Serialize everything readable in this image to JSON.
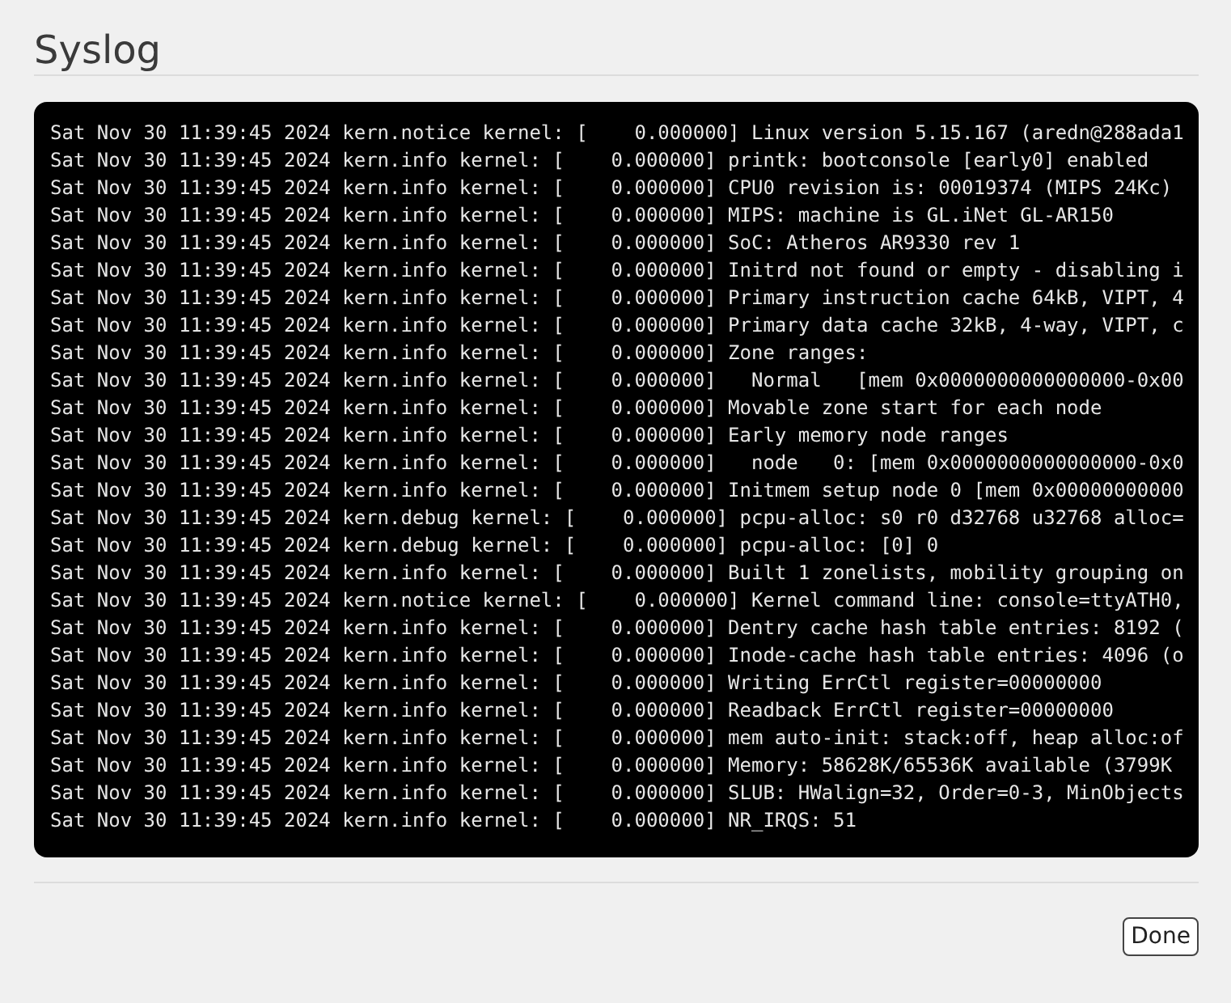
{
  "page": {
    "title": "Syslog"
  },
  "log": {
    "lines": [
      "Sat Nov 30 11:39:45 2024 kern.notice kernel: [    0.000000] Linux version 5.15.167 (aredn@288ada1",
      "Sat Nov 30 11:39:45 2024 kern.info kernel: [    0.000000] printk: bootconsole [early0] enabled",
      "Sat Nov 30 11:39:45 2024 kern.info kernel: [    0.000000] CPU0 revision is: 00019374 (MIPS 24Kc)",
      "Sat Nov 30 11:39:45 2024 kern.info kernel: [    0.000000] MIPS: machine is GL.iNet GL-AR150",
      "Sat Nov 30 11:39:45 2024 kern.info kernel: [    0.000000] SoC: Atheros AR9330 rev 1",
      "Sat Nov 30 11:39:45 2024 kern.info kernel: [    0.000000] Initrd not found or empty - disabling i",
      "Sat Nov 30 11:39:45 2024 kern.info kernel: [    0.000000] Primary instruction cache 64kB, VIPT, 4",
      "Sat Nov 30 11:39:45 2024 kern.info kernel: [    0.000000] Primary data cache 32kB, 4-way, VIPT, c",
      "Sat Nov 30 11:39:45 2024 kern.info kernel: [    0.000000] Zone ranges:",
      "Sat Nov 30 11:39:45 2024 kern.info kernel: [    0.000000]   Normal   [mem 0x0000000000000000-0x00",
      "Sat Nov 30 11:39:45 2024 kern.info kernel: [    0.000000] Movable zone start for each node",
      "Sat Nov 30 11:39:45 2024 kern.info kernel: [    0.000000] Early memory node ranges",
      "Sat Nov 30 11:39:45 2024 kern.info kernel: [    0.000000]   node   0: [mem 0x0000000000000000-0x0",
      "Sat Nov 30 11:39:45 2024 kern.info kernel: [    0.000000] Initmem setup node 0 [mem 0x00000000000",
      "Sat Nov 30 11:39:45 2024 kern.debug kernel: [    0.000000] pcpu-alloc: s0 r0 d32768 u32768 alloc=",
      "Sat Nov 30 11:39:45 2024 kern.debug kernel: [    0.000000] pcpu-alloc: [0] 0",
      "Sat Nov 30 11:39:45 2024 kern.info kernel: [    0.000000] Built 1 zonelists, mobility grouping on",
      "Sat Nov 30 11:39:45 2024 kern.notice kernel: [    0.000000] Kernel command line: console=ttyATH0,",
      "Sat Nov 30 11:39:45 2024 kern.info kernel: [    0.000000] Dentry cache hash table entries: 8192 (",
      "Sat Nov 30 11:39:45 2024 kern.info kernel: [    0.000000] Inode-cache hash table entries: 4096 (o",
      "Sat Nov 30 11:39:45 2024 kern.info kernel: [    0.000000] Writing ErrCtl register=00000000",
      "Sat Nov 30 11:39:45 2024 kern.info kernel: [    0.000000] Readback ErrCtl register=00000000",
      "Sat Nov 30 11:39:45 2024 kern.info kernel: [    0.000000] mem auto-init: stack:off, heap alloc:of",
      "Sat Nov 30 11:39:45 2024 kern.info kernel: [    0.000000] Memory: 58628K/65536K available (3799K",
      "Sat Nov 30 11:39:45 2024 kern.info kernel: [    0.000000] SLUB: HWalign=32, Order=0-3, MinObjects",
      "Sat Nov 30 11:39:45 2024 kern.info kernel: [    0.000000] NR_IRQS: 51"
    ]
  },
  "buttons": [
    {
      "label": "Done"
    }
  ]
}
